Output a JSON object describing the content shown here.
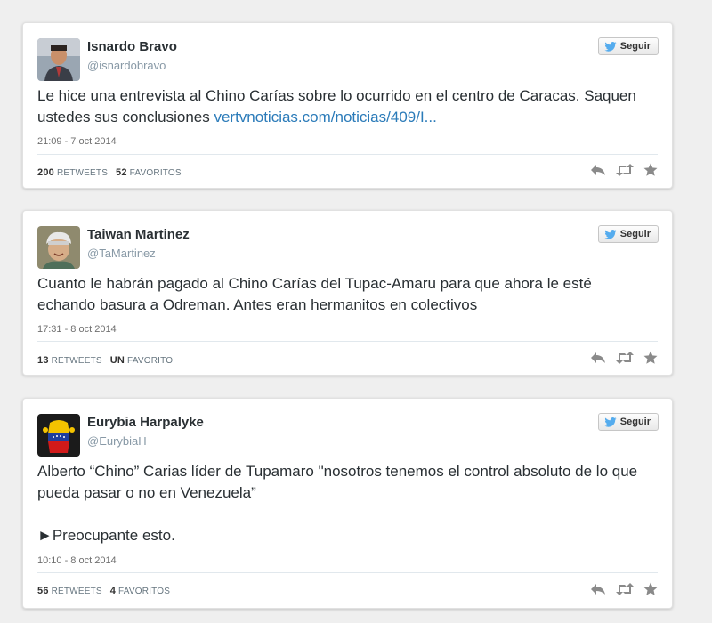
{
  "tweets": [
    {
      "name": "Isnardo Bravo",
      "handle": "@isnardobravo",
      "follow_label": "Seguir",
      "text_lines": [
        "Le hice una entrevista al Chino Carías sobre lo ocurrido en el centro de Caracas. Saquen ustedes sus conclusiones "
      ],
      "link": "vertvnoticias.com/noticias/409/I...",
      "timestamp": "21:09 - 7 oct 2014",
      "retweets_count": "200",
      "retweets_label": "RETWEETS",
      "favorites_count": "52",
      "favorites_label": "FAVORITOS"
    },
    {
      "name": "Taiwan Martinez",
      "handle": "@TaMartinez",
      "follow_label": "Seguir",
      "text_lines": [
        "Cuanto le habrán pagado al Chino Carías del Tupac-Amaru para que ahora le esté echando basura a Odreman. Antes eran hermanitos en colectivos"
      ],
      "timestamp": "17:31 - 8 oct 2014",
      "retweets_count": "13",
      "retweets_label": "RETWEETS",
      "favorites_count": "UN",
      "favorites_label": "FAVORITO"
    },
    {
      "name": "Eurybia Harpalyke",
      "handle": "@EurybiaH",
      "follow_label": "Seguir",
      "text_lines": [
        "Alberto “Chino” Carias líder de Tupamaro \"nosotros tenemos el control absoluto de lo que pueda pasar o no en Venezuela”",
        "►Preocupante esto."
      ],
      "timestamp": "10:10 - 8 oct 2014",
      "retweets_count": "56",
      "retweets_label": "RETWEETS",
      "favorites_count": "4",
      "favorites_label": "FAVORITOS"
    }
  ],
  "colors": {
    "link": "#2b7bb9",
    "twitter_blue": "#55acee",
    "action_gray": "#8a8a8a"
  },
  "icons": {
    "follow": "twitter-bird-icon",
    "reply": "reply-icon",
    "retweet": "retweet-icon",
    "favorite": "star-icon"
  }
}
